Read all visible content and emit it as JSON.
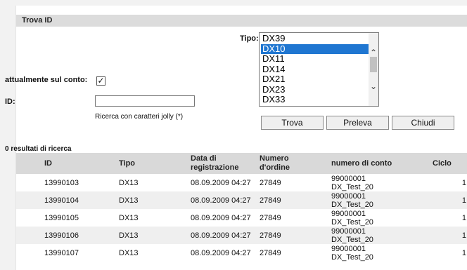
{
  "title": "Trova ID",
  "tipo_label": "Tipo:",
  "tipo_options": [
    "DX39",
    "DX10",
    "DX11",
    "DX14",
    "DX21",
    "DX23",
    "DX33"
  ],
  "tipo_selected_index": 1,
  "current_account_label": "attualmente sul conto:",
  "current_account_checked": true,
  "id_label": "ID:",
  "id_value": "",
  "wildcard_hint": "Ricerca con caratteri jolly (*)",
  "buttons": {
    "find": "Trova",
    "withdraw": "Preleva",
    "close": "Chiudi"
  },
  "results_count": "0 resultati di ricerca",
  "columns": {
    "id": "ID",
    "type": "Tipo",
    "date_l1": "Data di",
    "date_l2": "registrazione",
    "order_l1": "Numero",
    "order_l2": "d'ordine",
    "account": "numero di conto",
    "cycle": "Ciclo"
  },
  "rows": [
    {
      "id": "13990103",
      "type": "DX13",
      "date": "08.09.2009 04:27",
      "order": "27849",
      "account_l1": "99000001",
      "account_l2": "DX_Test_20",
      "cycle": "1"
    },
    {
      "id": "13990104",
      "type": "DX13",
      "date": "08.09.2009 04:27",
      "order": "27849",
      "account_l1": "99000001",
      "account_l2": "DX_Test_20",
      "cycle": "1"
    },
    {
      "id": "13990105",
      "type": "DX13",
      "date": "08.09.2009 04:27",
      "order": "27849",
      "account_l1": "99000001",
      "account_l2": "DX_Test_20",
      "cycle": "1"
    },
    {
      "id": "13990106",
      "type": "DX13",
      "date": "08.09.2009 04:27",
      "order": "27849",
      "account_l1": "99000001",
      "account_l2": "DX_Test_20",
      "cycle": "1"
    },
    {
      "id": "13990107",
      "type": "DX13",
      "date": "08.09.2009 04:27",
      "order": "27849",
      "account_l1": "99000001",
      "account_l2": "DX_Test_20",
      "cycle": "1"
    }
  ]
}
